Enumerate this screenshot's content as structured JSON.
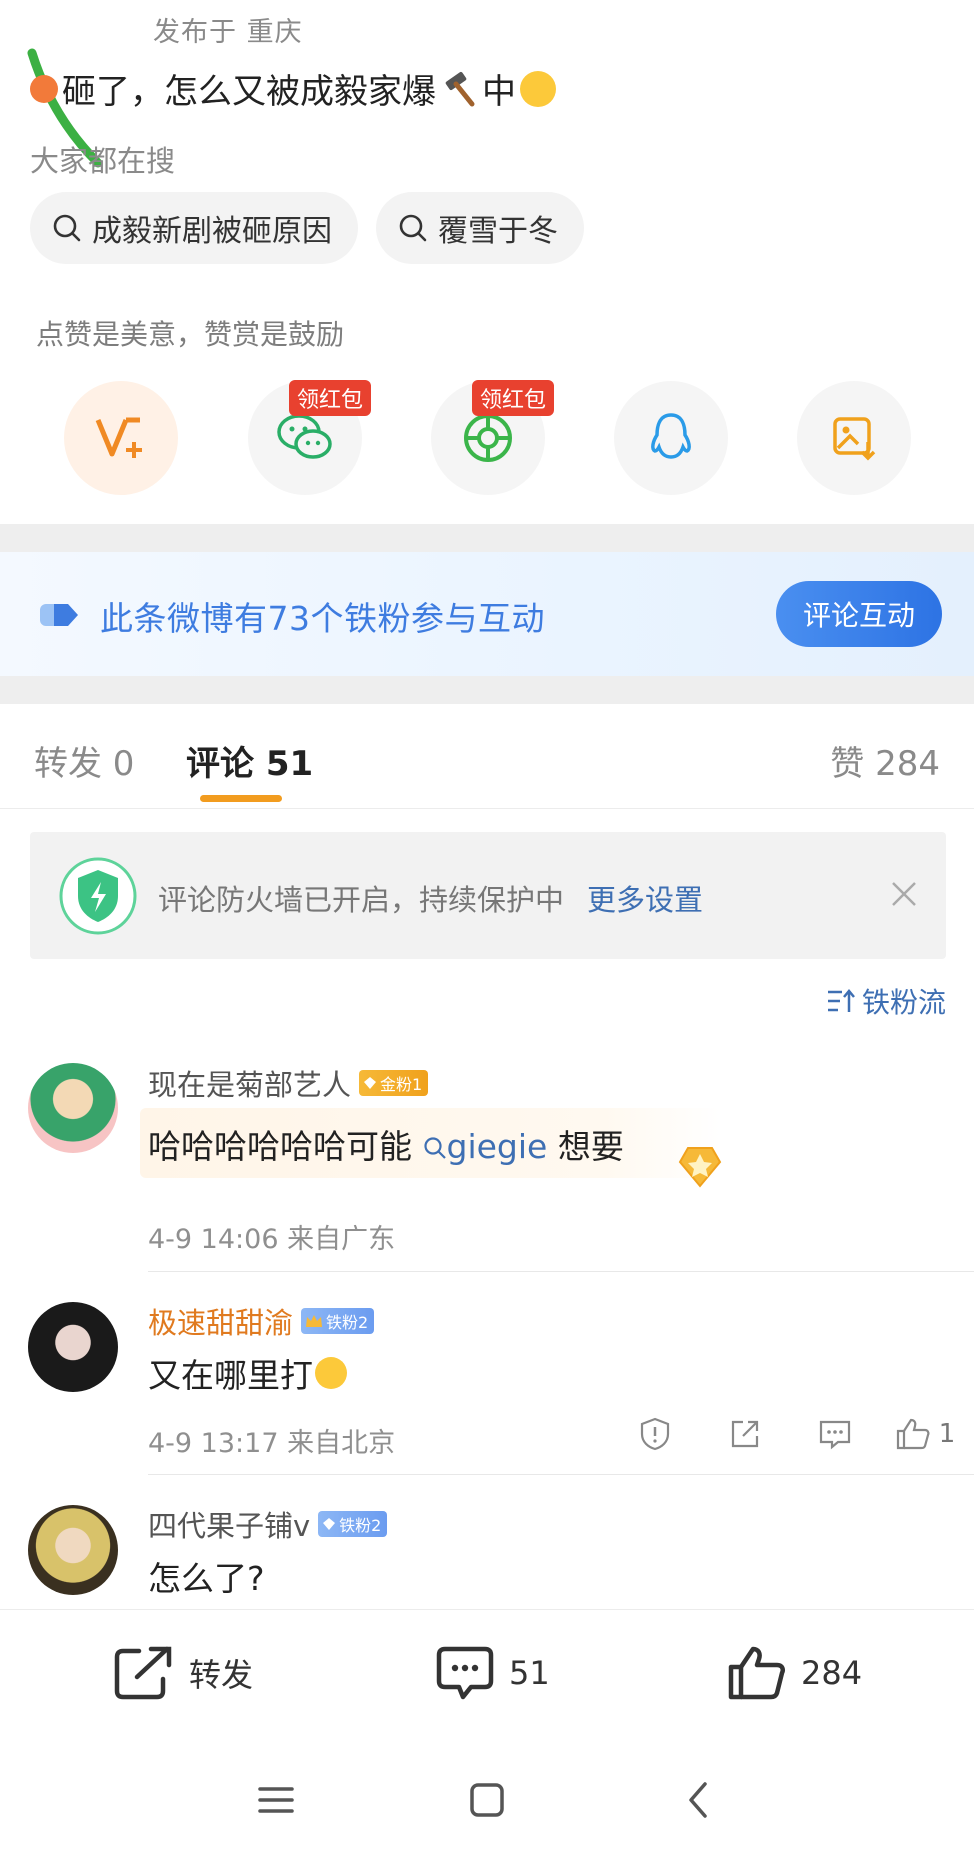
{
  "post": {
    "location": "发布于 重庆",
    "text_a": "砸了，怎么又被成毅家爆",
    "text_b": "中"
  },
  "search": {
    "hint": "大家都在搜",
    "chips": [
      "成毅新剧被砸原因",
      "覆雪于冬"
    ]
  },
  "reward": {
    "hint": "点赞是美意，赞赏是鼓励",
    "red_tag": "领红包"
  },
  "fans_banner": {
    "text": "此条微博有73个铁粉参与互动",
    "button": "评论互动"
  },
  "tabs": {
    "repost": "转发 0",
    "comment": "评论 51",
    "like": "赞 284"
  },
  "firewall": {
    "text": "评论防火墙已开启，持续保护中",
    "link": "更多设置"
  },
  "sort_toggle": "铁粉流",
  "comments": [
    {
      "name": "现在是菊部艺人",
      "badge": "金粉1",
      "body_a": "哈哈哈哈哈哈可能",
      "mention": "giegie",
      "body_b": " 想要",
      "meta": "4-9 14:06  来自广东"
    },
    {
      "name": "极速甜甜渝",
      "badge": "铁粉2",
      "body": "又在哪里打",
      "meta": "4-9 13:17  来自北京",
      "likes": "1"
    },
    {
      "name": "四代果子铺v",
      "badge": "铁粉2",
      "body": "怎么了?"
    }
  ],
  "bottom_bar": {
    "repost": "转发",
    "comment": "51",
    "like": "284"
  },
  "colors": {
    "accent_orange": "#f29c1f",
    "link_blue": "#3e6fb3",
    "banner_blue": "#3e7ce0",
    "red_tag": "#e8412f"
  }
}
